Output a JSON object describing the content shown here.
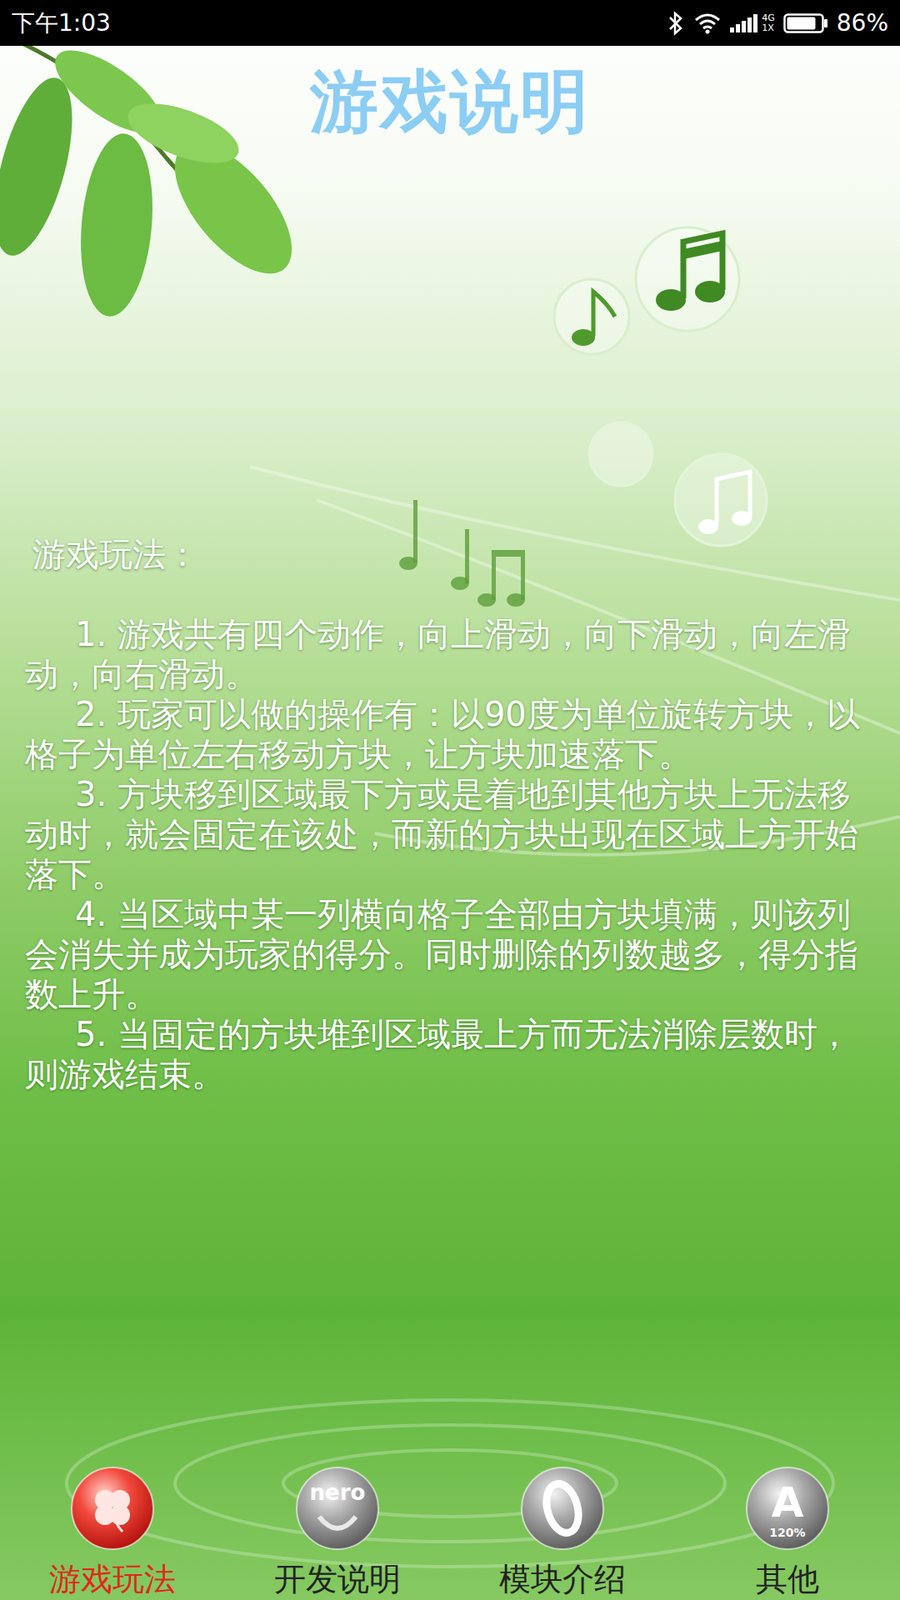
{
  "status_bar": {
    "time": "下午1:03",
    "network_top": "4G",
    "network_bottom": "1X",
    "battery": "86%",
    "battery_level": 0.86
  },
  "title": "游戏说明",
  "content": {
    "heading": "游戏玩法：",
    "rules": [
      "1. 游戏共有四个动作，向上滑动，向下滑动，向左滑动，向右滑动。",
      "2. 玩家可以做的操作有：以90度为单位旋转方块，以格子为单位左右移动方块，让方块加速落下。",
      "3. 方块移到区域最下方或是着地到其他方块上无法移动时，就会固定在该处，而新的方块出现在区域上方开始落下。",
      "4. 当区域中某一列横向格子全部由方块填满，则该列会消失并成为玩家的得分。同时删除的列数越多，得分指数上升。",
      "5. 当固定的方块堆到区域最上方而无法消除层数时，则游戏结束。"
    ]
  },
  "tabs": [
    {
      "label": "游戏玩法",
      "selected": true,
      "kind": "clover"
    },
    {
      "label": "开发说明",
      "selected": false,
      "kind": "nero",
      "icon_text": "nero"
    },
    {
      "label": "模块介绍",
      "selected": false,
      "kind": "ring"
    },
    {
      "label": "其他",
      "selected": false,
      "kind": "letter",
      "icon_text": "A",
      "icon_subtext": "120%"
    }
  ]
}
